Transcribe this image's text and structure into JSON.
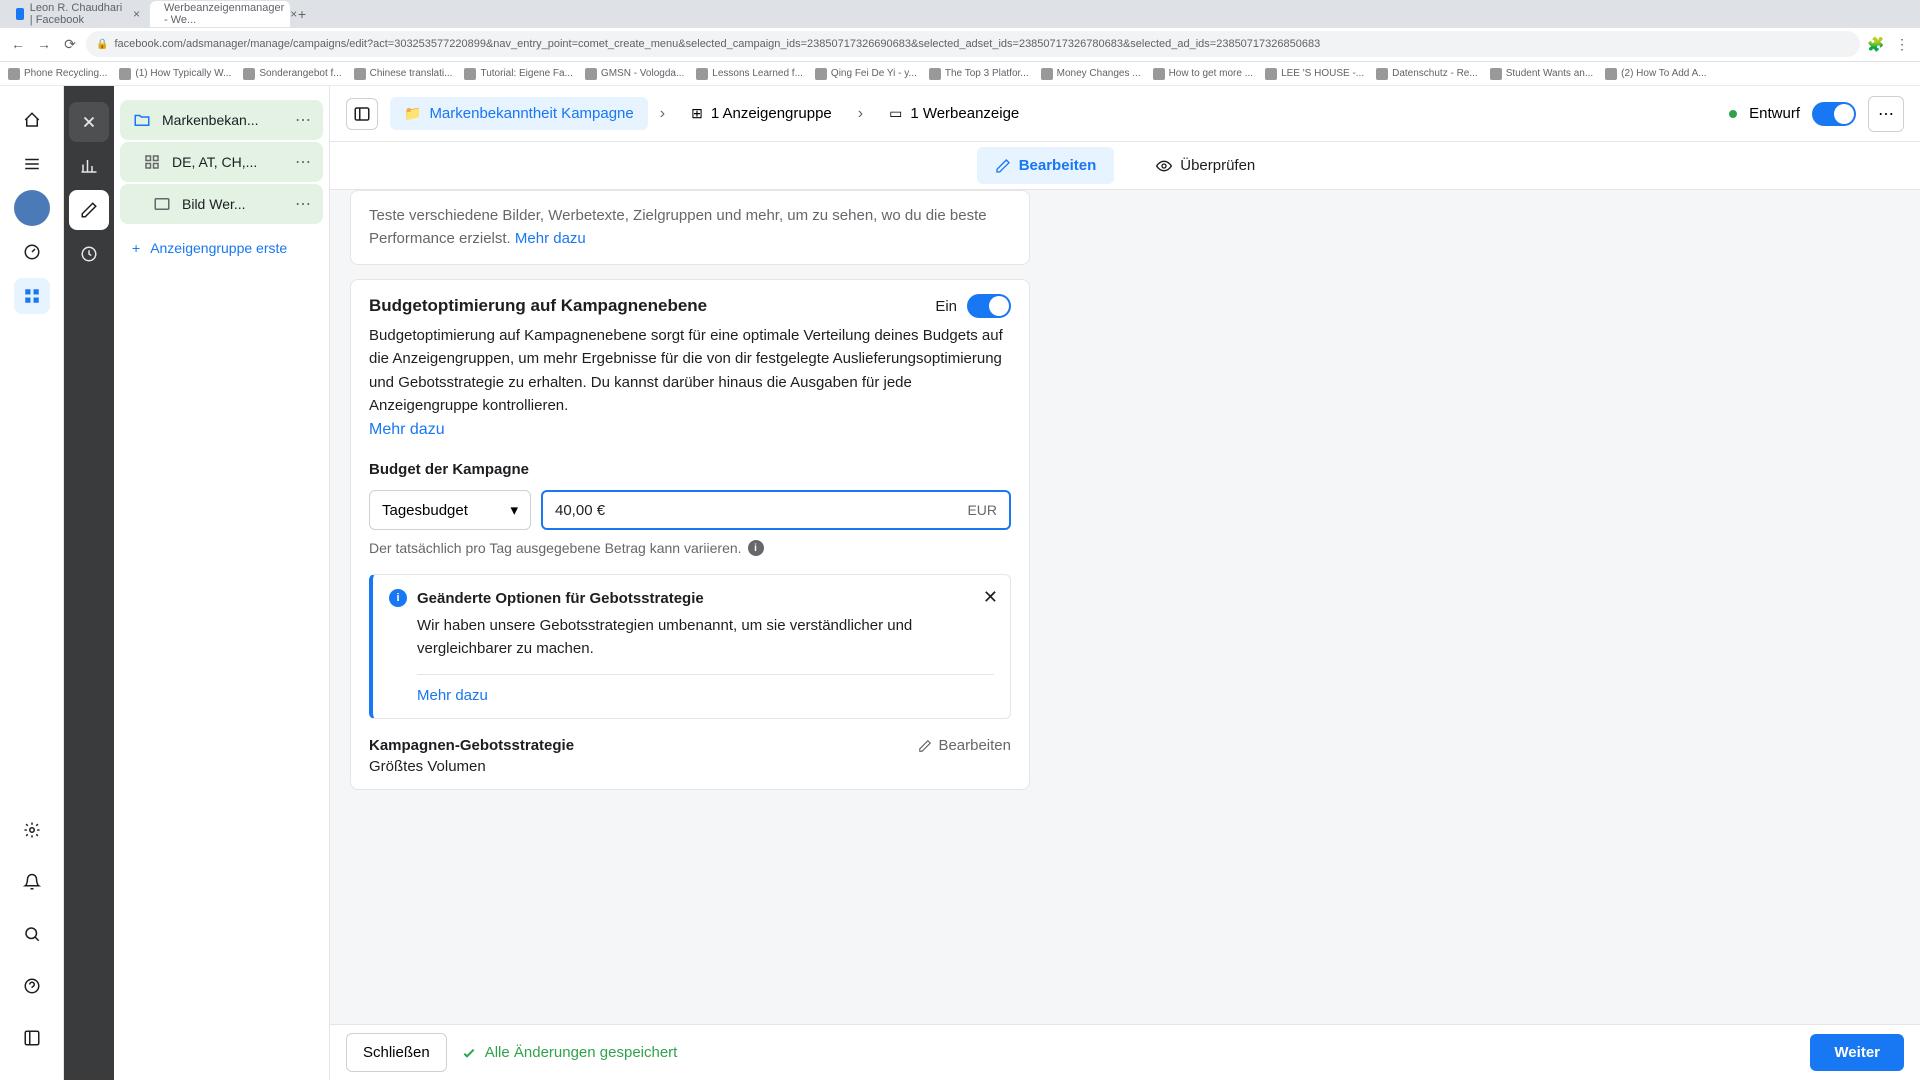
{
  "browser": {
    "tabs": [
      {
        "title": "Leon R. Chaudhari | Facebook"
      },
      {
        "title": "Werbeanzeigenmanager - We..."
      }
    ],
    "url": "facebook.com/adsmanager/manage/campaigns/edit?act=303253577220899&nav_entry_point=comet_create_menu&selected_campaign_ids=23850717326690683&selected_adset_ids=23850717326780683&selected_ad_ids=23850717326850683",
    "bookmarks": [
      "Phone Recycling...",
      "(1) How Typically W...",
      "Sonderangebot f...",
      "Chinese translati...",
      "Tutorial: Eigene Fa...",
      "GMSN - Vologda...",
      "Lessons Learned f...",
      "Qing Fei De Yi - y...",
      "The Top 3 Platfor...",
      "Money Changes ...",
      "How to get more ...",
      "LEE 'S HOUSE -...",
      "Datenschutz - Re...",
      "Student Wants an...",
      "(2) How To Add A..."
    ]
  },
  "tree": {
    "campaign": "Markenbekan...",
    "adset": "DE, AT, CH,...",
    "ad": "Bild Wer...",
    "add": "Anzeigengruppe erste"
  },
  "crumbs": {
    "c1": "Markenbekanntheit Kampagne",
    "c2": "1 Anzeigengruppe",
    "c3": "1 Werbeanzeige"
  },
  "header": {
    "status": "Entwurf",
    "edit": "Bearbeiten",
    "review": "Überprüfen"
  },
  "truncated": {
    "text": "Teste verschiedene Bilder, Werbetexte, Zielgruppen und mehr, um zu sehen, wo du die beste Performance erzielst.",
    "link": "Mehr dazu"
  },
  "budget": {
    "title": "Budgetoptimierung auf Kampagnenebene",
    "toggle": "Ein",
    "desc": "Budgetoptimierung auf Kampagnenebene sorgt für eine optimale Verteilung deines Budgets auf die Anzeigengruppen, um mehr Ergebnisse für die von dir festgelegte Auslieferungsoptimierung und Gebotsstrategie zu erhalten. Du kannst darüber hinaus die Ausgaben für jede Anzeigengruppe kontrollieren.",
    "more": "Mehr dazu",
    "field_label": "Budget der Kampagne",
    "select": "Tagesbudget",
    "value": "40,00 €",
    "currency": "EUR",
    "hint": "Der tatsächlich pro Tag ausgegebene Betrag kann variieren."
  },
  "info": {
    "title": "Geänderte Optionen für Gebotsstrategie",
    "body": "Wir haben unsere Gebotsstrategien umbenannt, um sie verständlicher und vergleichbarer zu machen.",
    "link": "Mehr dazu"
  },
  "strategy": {
    "title": "Kampagnen-Gebotsstrategie",
    "value": "Größtes Volumen",
    "edit": "Bearbeiten"
  },
  "footer": {
    "close": "Schließen",
    "saved": "Alle Änderungen gespeichert",
    "next": "Weiter"
  }
}
